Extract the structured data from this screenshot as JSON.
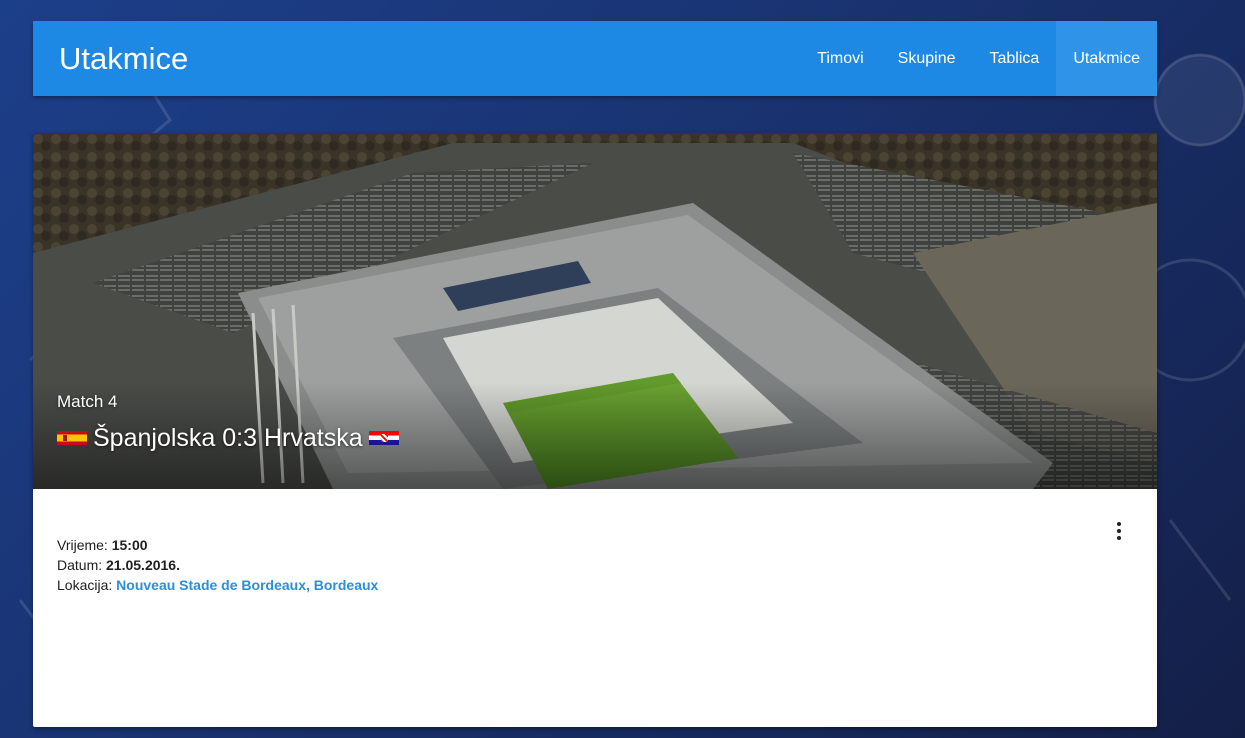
{
  "appbar": {
    "title": "Utakmice",
    "nav": [
      {
        "label": "Timovi",
        "active": false
      },
      {
        "label": "Skupine",
        "active": false
      },
      {
        "label": "Tablica",
        "active": false
      },
      {
        "label": "Utakmice",
        "active": true
      }
    ]
  },
  "match": {
    "label": "Match 4",
    "home_team": "Španjolska",
    "score": "0:3",
    "away_team": "Hrvatska",
    "home_flag_icon": "spain-flag-icon",
    "away_flag_icon": "croatia-flag-icon"
  },
  "details": {
    "time_label": "Vrijeme:",
    "time_value": "15:00",
    "date_label": "Datum:",
    "date_value": "21.05.2016.",
    "location_label": "Lokacija:",
    "location_value": "Nouveau Stade de Bordeaux, Bordeaux"
  },
  "colors": {
    "primary": "#1e88e5",
    "nav_active": "#2f93e8",
    "link": "#2b8fd9",
    "background": "#1a3473"
  },
  "menu_icon": "more-vert-icon"
}
